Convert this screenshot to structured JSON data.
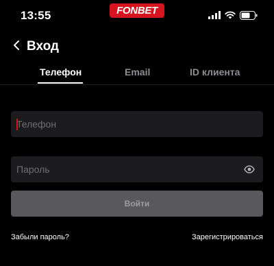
{
  "status_bar": {
    "time": "13:55",
    "brand": "FONBET",
    "icons": [
      "cellular-signal-icon",
      "wifi-icon",
      "battery-icon"
    ]
  },
  "header": {
    "title": "Вход",
    "back_icon": "chevron-left-icon"
  },
  "tabs": [
    {
      "label": "Телефон",
      "active": true
    },
    {
      "label": "Email",
      "active": false
    },
    {
      "label": "ID клиента",
      "active": false
    }
  ],
  "form": {
    "phone": {
      "placeholder": "Телефон",
      "value": ""
    },
    "password": {
      "placeholder": "Пароль",
      "value": "",
      "toggle_icon": "eye-icon"
    },
    "submit_label": "Войти"
  },
  "links": {
    "forgot_password": "Забыли пароль?",
    "register": "Зарегистрироваться"
  },
  "colors": {
    "background": "#000000",
    "field": "#1c1c1e",
    "brand": "#d5141f",
    "button_disabled": "#58585d",
    "muted_text": "#8e8e93"
  }
}
